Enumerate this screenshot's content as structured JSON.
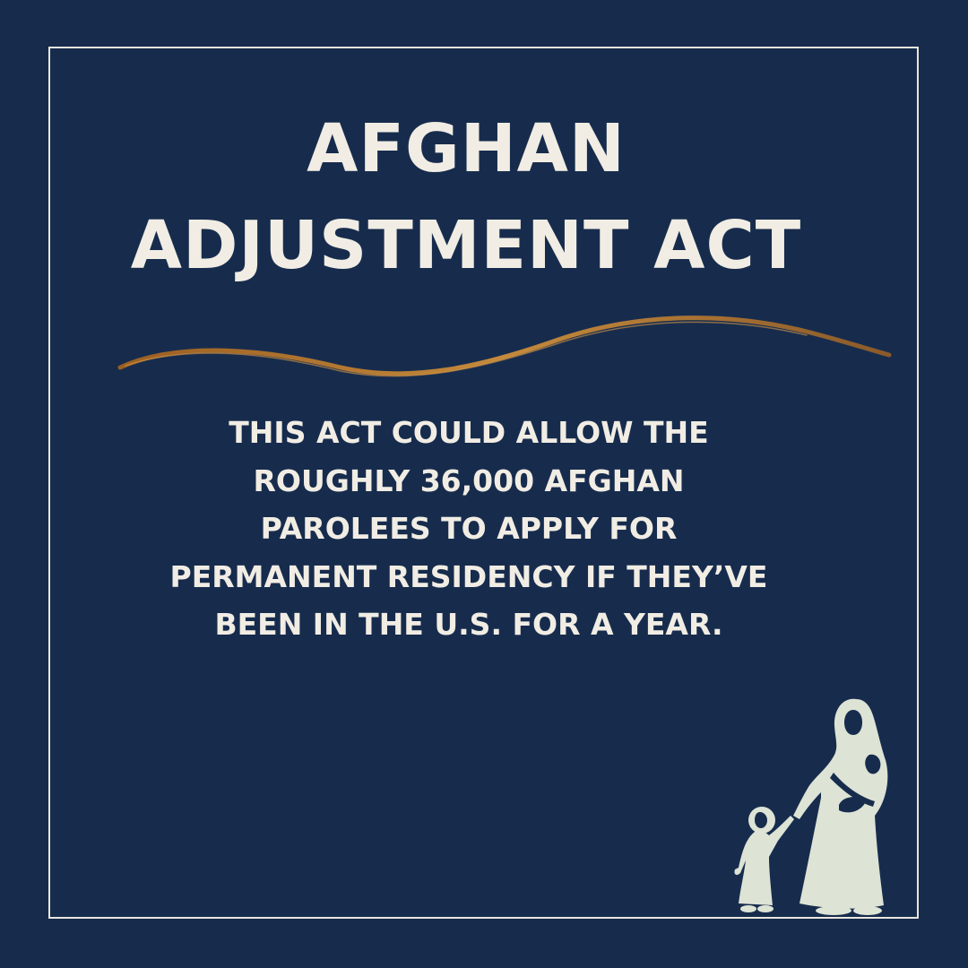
{
  "title_lines": [
    "AFGHAN",
    "ADJUSTMENT ACT"
  ],
  "body_lines": [
    "THIS ACT COULD ALLOW THE",
    "ROUGHLY 36,000 AFGHAN",
    "PAROLEES TO APPLY FOR",
    "PERMANENT RESIDENCY IF THEY’VE",
    "BEEN IN THE U.S. FOR A YEAR."
  ],
  "colors": {
    "background": "#172c4d",
    "text": "#f1ede4",
    "accent_wave": "#b8792f",
    "illustration": "#dde3d5"
  },
  "icons": [
    "wave-divider",
    "mother-and-children-icon"
  ]
}
